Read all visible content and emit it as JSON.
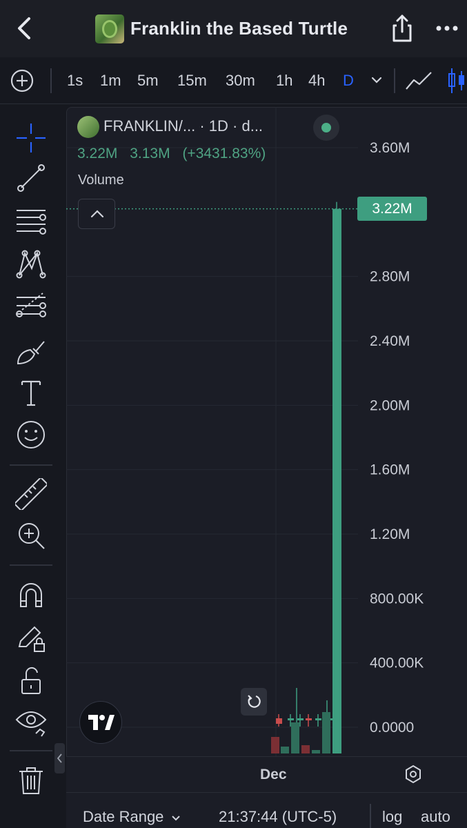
{
  "header": {
    "title": "Franklin the Based Turtle",
    "icons": [
      "back-icon",
      "token-logo",
      "share-icon",
      "more-icon"
    ]
  },
  "toolbar": {
    "timeframes": [
      "1s",
      "1m",
      "5m",
      "15m",
      "30m",
      "1h",
      "4h",
      "D"
    ],
    "active_timeframe": "D",
    "icons": [
      "add-icon",
      "chevron-down-icon",
      "line-chart-icon",
      "candlestick-icon"
    ]
  },
  "sidebar": {
    "tools": [
      "crosshair-icon",
      "trendline-icon",
      "horizontal-lines-icon",
      "pattern-icon",
      "fib-icon",
      "brush-icon",
      "text-icon",
      "emoji-icon",
      "ruler-icon",
      "zoom-in-icon",
      "magnet-icon",
      "pencil-lock-icon",
      "unlock-icon",
      "eye-icon",
      "trash-icon"
    ]
  },
  "legend": {
    "symbol": "FRANKLIN/... · 1D · d...",
    "value_1": "3.22M",
    "value_2": "3.13M",
    "change": "(+3431.83%)",
    "indicator": "Volume"
  },
  "colors": {
    "up": "#3e9e80",
    "down": "#c94c4c",
    "accent": "#2962ff"
  },
  "chart_data": {
    "type": "bar",
    "title": "Volume",
    "y_ticks": [
      "3.60M",
      "2.80M",
      "2.40M",
      "2.00M",
      "1.60M",
      "1.20M",
      "800.00K",
      "400.00K",
      "0.0000"
    ],
    "ylim": [
      0,
      3600000
    ],
    "current_value_label": "3.22M",
    "current_value": 3220000,
    "x_tick": "Dec",
    "bars": [
      {
        "value": 1000,
        "color": "down"
      },
      {
        "value": 1200,
        "color": "up"
      },
      {
        "value": 1300,
        "color": "up"
      },
      {
        "value": 1100,
        "color": "down"
      },
      {
        "value": 1150,
        "color": "up"
      },
      {
        "value": 1600,
        "color": "up"
      },
      {
        "value": 3220000,
        "color": "up"
      }
    ]
  },
  "footer": {
    "date_range": "Date Range",
    "time": "21:37:44 (UTC-5)",
    "log": "log",
    "auto": "auto"
  }
}
